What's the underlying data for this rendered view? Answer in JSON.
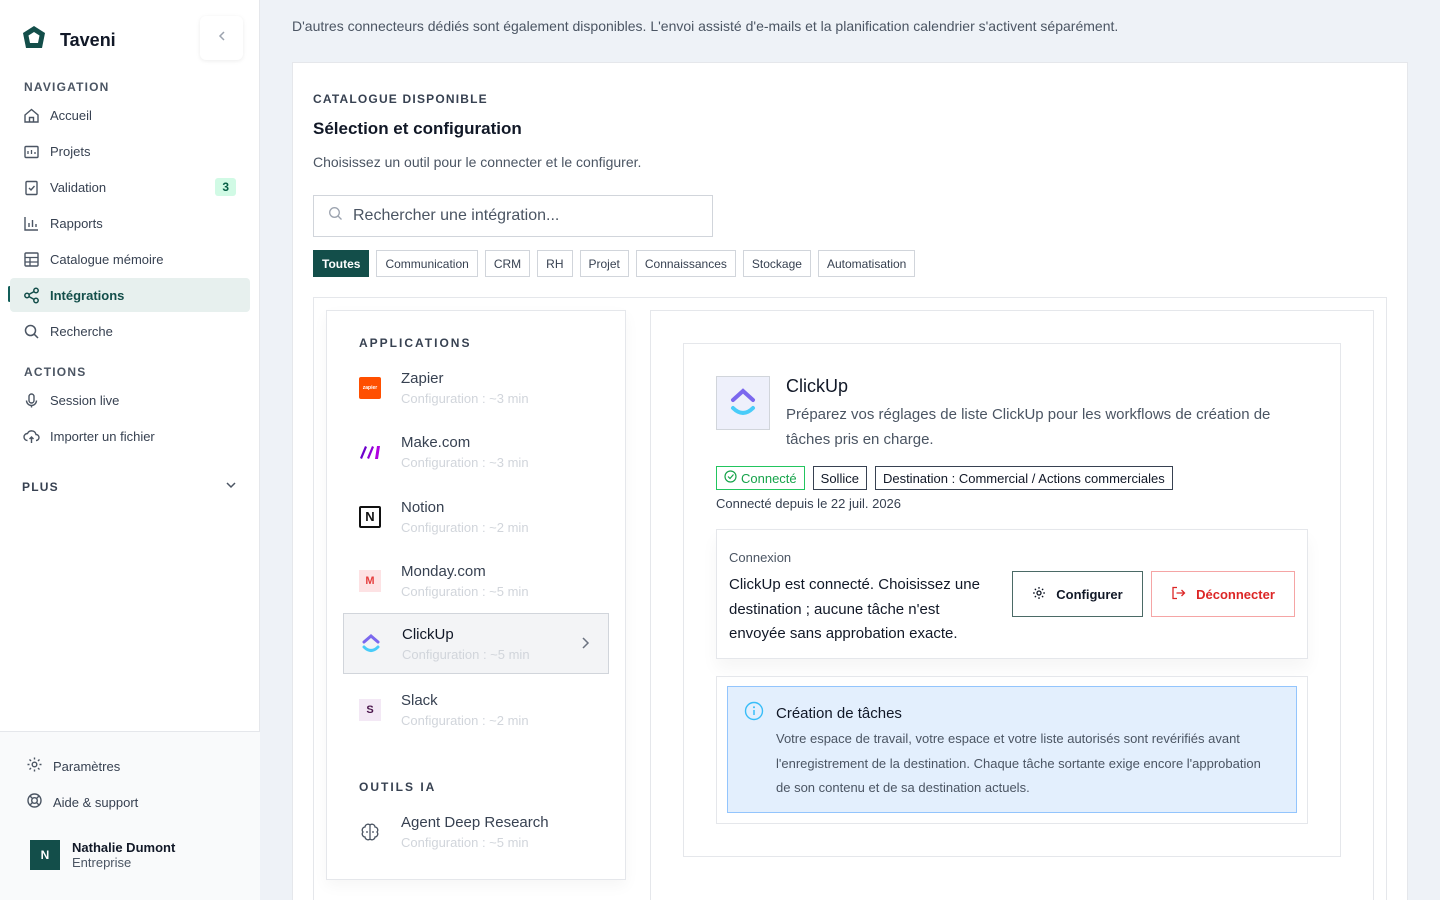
{
  "app": {
    "name": "Taveni"
  },
  "sidebar": {
    "nav_label": "NAVIGATION",
    "items": [
      {
        "label": "Accueil",
        "icon": "home-icon"
      },
      {
        "label": "Projets",
        "icon": "folder-icon"
      },
      {
        "label": "Validation",
        "icon": "clipboard-check-icon",
        "badge": "3"
      },
      {
        "label": "Rapports",
        "icon": "bar-chart-icon"
      },
      {
        "label": "Catalogue mémoire",
        "icon": "table-icon"
      },
      {
        "label": "Intégrations",
        "icon": "share-nodes-icon",
        "active": true
      },
      {
        "label": "Recherche",
        "icon": "search-icon"
      }
    ],
    "actions_label": "ACTIONS",
    "actions": [
      {
        "label": "Session live",
        "icon": "mic-icon"
      },
      {
        "label": "Importer un fichier",
        "icon": "cloud-upload-icon"
      }
    ],
    "more_label": "PLUS",
    "footer": {
      "settings": "Paramètres",
      "help": "Aide & support"
    },
    "user": {
      "initial": "N",
      "name": "Nathalie Dumont",
      "plan": "Entreprise"
    }
  },
  "main": {
    "top_note": "D'autres connecteurs dédiés sont également disponibles. L'envoi assisté d'e-mails et la planification calendrier s'activent séparément.",
    "eyebrow": "CATALOGUE DISPONIBLE",
    "title": "Sélection et configuration",
    "subtitle": "Choisissez un outil pour le connecter et le configurer.",
    "search_placeholder": "Rechercher une intégration...",
    "filters": [
      "Toutes",
      "Communication",
      "CRM",
      "RH",
      "Projet",
      "Connaissances",
      "Stockage",
      "Automatisation"
    ],
    "active_filter": "Toutes",
    "apps_label": "APPLICATIONS",
    "apps": [
      {
        "name": "Zapier",
        "meta": "Configuration : ~3 min",
        "logo_text": "zapier",
        "color": "#ff4f00"
      },
      {
        "name": "Make.com",
        "meta": "Configuration : ~3 min",
        "color": "#6d00cc"
      },
      {
        "name": "Notion",
        "meta": "Configuration : ~2 min",
        "logo_text": "N",
        "color": "#111111"
      },
      {
        "name": "Monday.com",
        "meta": "Configuration : ~5 min",
        "logo_text": "M",
        "color": "#e53e3e"
      },
      {
        "name": "ClickUp",
        "meta": "Configuration : ~5 min",
        "active": true,
        "color": "#7b68ee"
      },
      {
        "name": "Slack",
        "meta": "Configuration : ~2 min",
        "logo_text": "S",
        "color": "#4a154b"
      }
    ],
    "ai_label": "OUTILS IA",
    "ai_tools": [
      {
        "name": "Agent Deep Research",
        "meta": "Configuration : ~5 min",
        "icon": "brain-icon"
      }
    ],
    "detail": {
      "name": "ClickUp",
      "description": "Préparez vos réglages de liste ClickUp pour les workflows de création de tâches pris en charge.",
      "tags": [
        "Connecté",
        "Sollice",
        "Destination : Commercial / Actions commerciales"
      ],
      "since": "Connecté depuis le 22 juil. 2026",
      "connection_label": "Connexion",
      "connection_text": "ClickUp est connecté. Choisissez une destination ; aucune tâche n'est envoyée sans approbation exacte.",
      "configure_label": "Configurer",
      "disconnect_label": "Déconnecter",
      "info_title": "Création de tâches",
      "info_text": "Votre espace de travail, votre espace et votre liste autorisés sont revérifiés avant l'enregistrement de la destination. Chaque tâche sortante exige encore l'approbation de son contenu et de sa destination actuels."
    }
  },
  "colors": {
    "accent": "#134e4a",
    "danger": "#dc2626",
    "success": "#16a34a",
    "info_bg": "#e3effd"
  }
}
